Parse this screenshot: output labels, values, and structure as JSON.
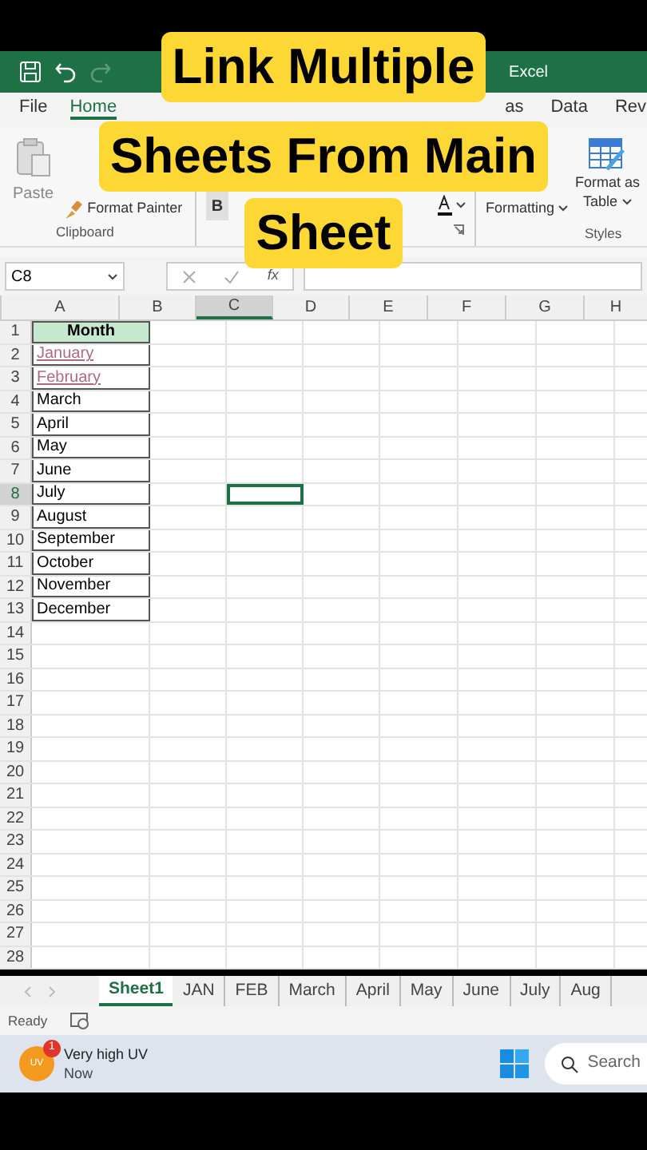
{
  "title_bar": {
    "app": "Excel"
  },
  "menu": [
    {
      "label": "File",
      "selected": false
    },
    {
      "label": "Home",
      "selected": true
    },
    {
      "label": "as",
      "selected": false
    },
    {
      "label": "Data",
      "selected": false
    },
    {
      "label": "Rev",
      "selected": false
    }
  ],
  "ribbon": {
    "paste": "Paste",
    "format_painter": "Format Painter",
    "clipboard": "Clipboard",
    "bold": "B",
    "formatting": "Formatting",
    "format_as": "Format as",
    "table": "Table",
    "styles": "Styles"
  },
  "caption": [
    "Link Multiple",
    "Sheets From Main",
    "Sheet"
  ],
  "name_box": "C8",
  "fx": "fx",
  "columns": [
    {
      "label": "A",
      "selected": false
    },
    {
      "label": "B",
      "selected": false
    },
    {
      "label": "C",
      "selected": true
    },
    {
      "label": "D",
      "selected": false
    },
    {
      "label": "E",
      "selected": false
    },
    {
      "label": "F",
      "selected": false
    },
    {
      "label": "G",
      "selected": false
    },
    {
      "label": "H",
      "selected": false
    }
  ],
  "rows": [
    {
      "label": "1",
      "selected": false,
      "cell": "Month",
      "kind": "header"
    },
    {
      "label": "2",
      "selected": false,
      "cell": "January",
      "kind": "link"
    },
    {
      "label": "3",
      "selected": false,
      "cell": "February",
      "kind": "link"
    },
    {
      "label": "4",
      "selected": false,
      "cell": "March",
      "kind": "text"
    },
    {
      "label": "5",
      "selected": false,
      "cell": "April",
      "kind": "text"
    },
    {
      "label": "6",
      "selected": false,
      "cell": "May",
      "kind": "text"
    },
    {
      "label": "7",
      "selected": false,
      "cell": "June",
      "kind": "text"
    },
    {
      "label": "8",
      "selected": true,
      "cell": "July",
      "kind": "text"
    },
    {
      "label": "9",
      "selected": false,
      "cell": "August",
      "kind": "text"
    },
    {
      "label": "10",
      "selected": false,
      "cell": "September",
      "kind": "text"
    },
    {
      "label": "11",
      "selected": false,
      "cell": "October",
      "kind": "text"
    },
    {
      "label": "12",
      "selected": false,
      "cell": "November",
      "kind": "text"
    },
    {
      "label": "13",
      "selected": false,
      "cell": "December",
      "kind": "text"
    },
    {
      "label": "14",
      "selected": false
    },
    {
      "label": "15",
      "selected": false
    },
    {
      "label": "16",
      "selected": false
    },
    {
      "label": "17",
      "selected": false
    },
    {
      "label": "18",
      "selected": false
    },
    {
      "label": "19",
      "selected": false
    },
    {
      "label": "20",
      "selected": false
    },
    {
      "label": "21",
      "selected": false
    },
    {
      "label": "22",
      "selected": false
    },
    {
      "label": "23",
      "selected": false
    },
    {
      "label": "24",
      "selected": false
    },
    {
      "label": "25",
      "selected": false
    },
    {
      "label": "26",
      "selected": false
    },
    {
      "label": "27",
      "selected": false
    },
    {
      "label": "28",
      "selected": false
    }
  ],
  "sheet_tabs": [
    {
      "label": "Sheet1",
      "selected": true
    },
    {
      "label": "JAN",
      "selected": false
    },
    {
      "label": "FEB",
      "selected": false
    },
    {
      "label": "March",
      "selected": false
    },
    {
      "label": "April",
      "selected": false
    },
    {
      "label": "May",
      "selected": false
    },
    {
      "label": "June",
      "selected": false
    },
    {
      "label": "July",
      "selected": false
    },
    {
      "label": "Aug",
      "selected": false
    }
  ],
  "status": "Ready",
  "taskbar": {
    "badge": "1",
    "icon_text": "UV",
    "title": "Very high UV",
    "time": "Now",
    "search": "Search"
  }
}
